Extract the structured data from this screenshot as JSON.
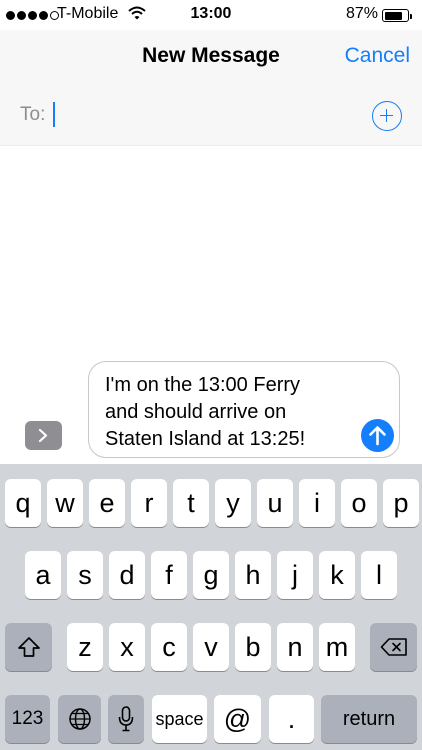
{
  "status_bar": {
    "carrier": "T-Mobile",
    "time": "13:00",
    "battery_percent": "87%",
    "signal_bars_filled": 4,
    "signal_bars_total": 5
  },
  "nav": {
    "title": "New Message",
    "cancel_label": "Cancel"
  },
  "recipient": {
    "label": "To:",
    "value": ""
  },
  "compose": {
    "message": "I'm on the 13:00 Ferry\nand should arrive on\nStaten Island at 13:25!"
  },
  "keyboard": {
    "row1": [
      "q",
      "w",
      "e",
      "r",
      "t",
      "y",
      "u",
      "i",
      "o",
      "p"
    ],
    "row2": [
      "a",
      "s",
      "d",
      "f",
      "g",
      "h",
      "j",
      "k",
      "l"
    ],
    "row3": [
      "z",
      "x",
      "c",
      "v",
      "b",
      "n",
      "m"
    ],
    "numbers_label": "123",
    "space_label": "space",
    "at_label": "@",
    "period_label": ".",
    "return_label": "return"
  },
  "colors": {
    "accent": "#147efb",
    "keyboard_bg": "#d1d4d9",
    "special_key": "#abb0ba"
  },
  "icons": [
    "wifi-icon",
    "battery-icon",
    "add-contact-icon",
    "expand-icon",
    "send-arrow-icon",
    "shift-icon",
    "globe-icon",
    "microphone-icon",
    "delete-icon"
  ]
}
